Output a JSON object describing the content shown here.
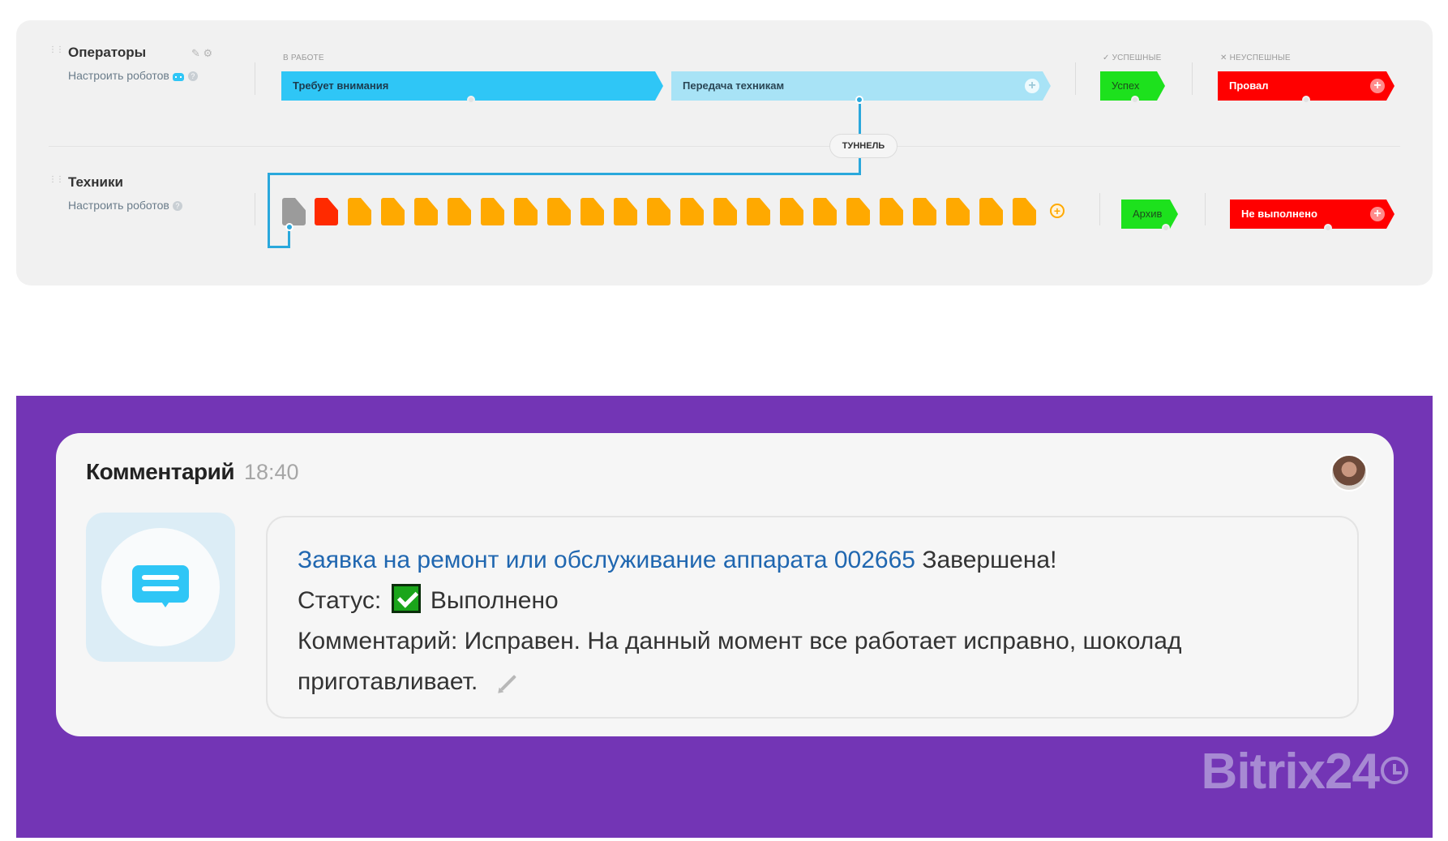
{
  "pipeline": {
    "operators": {
      "title": "Операторы",
      "robots_link": "Настроить роботов"
    },
    "technicians": {
      "title": "Техники",
      "robots_link": "Настроить роботов"
    },
    "groups": {
      "in_work": "В РАБОТЕ",
      "successful": "УСПЕШНЫЕ",
      "unsuccessful": "НЕУСПЕШНЫЕ"
    },
    "operator_stages": {
      "needs_attention": "Требует внимания",
      "handover": "Передача техникам",
      "success": "Успех",
      "failure": "Провал"
    },
    "technician_stages": {
      "archive": "Архив",
      "not_done": "Не выполнено",
      "mini_stage_count": 23
    },
    "tunnel_label": "ТУННЕЛЬ",
    "colors": {
      "blue": "#2fc6f6",
      "light_blue": "#a8e3f6",
      "green": "#1de11d",
      "red": "#ff0000",
      "orange": "#ffa900",
      "gray": "#9b9b9b"
    }
  },
  "comment": {
    "title": "Комментарий",
    "time": "18:40",
    "link_text": "Заявка на ремонт или обслуживание аппарата 002665",
    "completed": "Завершена!",
    "status_label": "Статус:",
    "status_value": "Выполнено",
    "comment_text": "Комментарий: Исправен. На данный момент все работает исправно, шоколад приготавливает."
  },
  "brand": {
    "name": "Bitrix24",
    "background": "#7335b5"
  }
}
